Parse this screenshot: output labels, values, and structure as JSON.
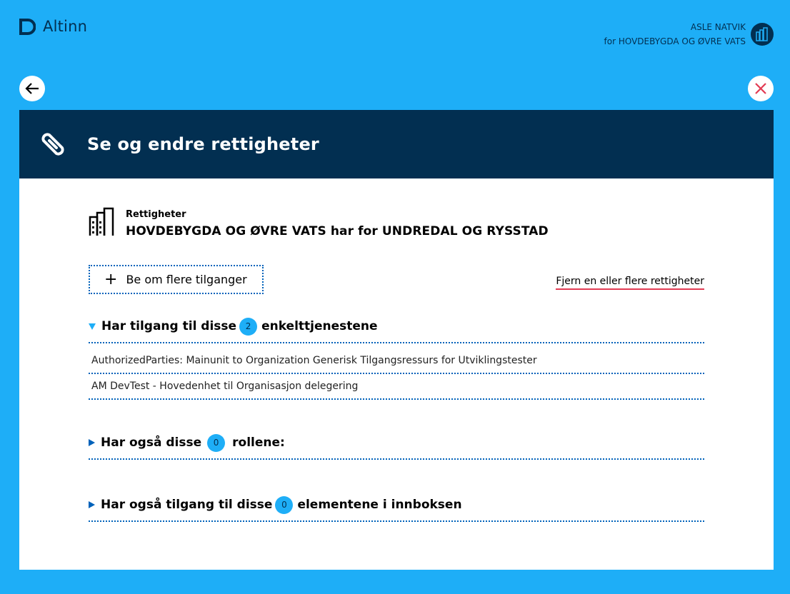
{
  "header": {
    "brand": "Altinn",
    "user_name": "ASLE NATVIK",
    "user_org": "for HOVDEBYGDA OG ØVRE VATS"
  },
  "panel": {
    "title": "Se og endre rettigheter"
  },
  "rights": {
    "label": "Rettigheter",
    "title": "HOVDEBYGDA OG ØVRE VATS har for UNDREDAL OG RYSSTAD"
  },
  "actions": {
    "request_label": "Be om flere tilganger",
    "remove_label": "Fjern en eller flere rettigheter"
  },
  "sections": [
    {
      "prefix": "Har tilgang til disse",
      "count": "2",
      "suffix": "enkelttjenestene",
      "expanded": true,
      "items": [
        "AuthorizedParties: Mainunit to Organization Generisk Tilgangsressurs for Utviklingstester",
        "AM DevTest - Hovedenhet til Organisasjon delegering"
      ]
    },
    {
      "prefix": "Har også disse",
      "count": "0",
      "suffix": "rollene:",
      "expanded": false
    },
    {
      "prefix": "Har også tilgang til disse",
      "count": "0",
      "suffix": "elementene i innboksen",
      "expanded": false
    }
  ],
  "colors": {
    "background": "#1eaef7",
    "navy": "#022f51",
    "accent_red": "#e23b53",
    "dotted": "#0062ba"
  }
}
